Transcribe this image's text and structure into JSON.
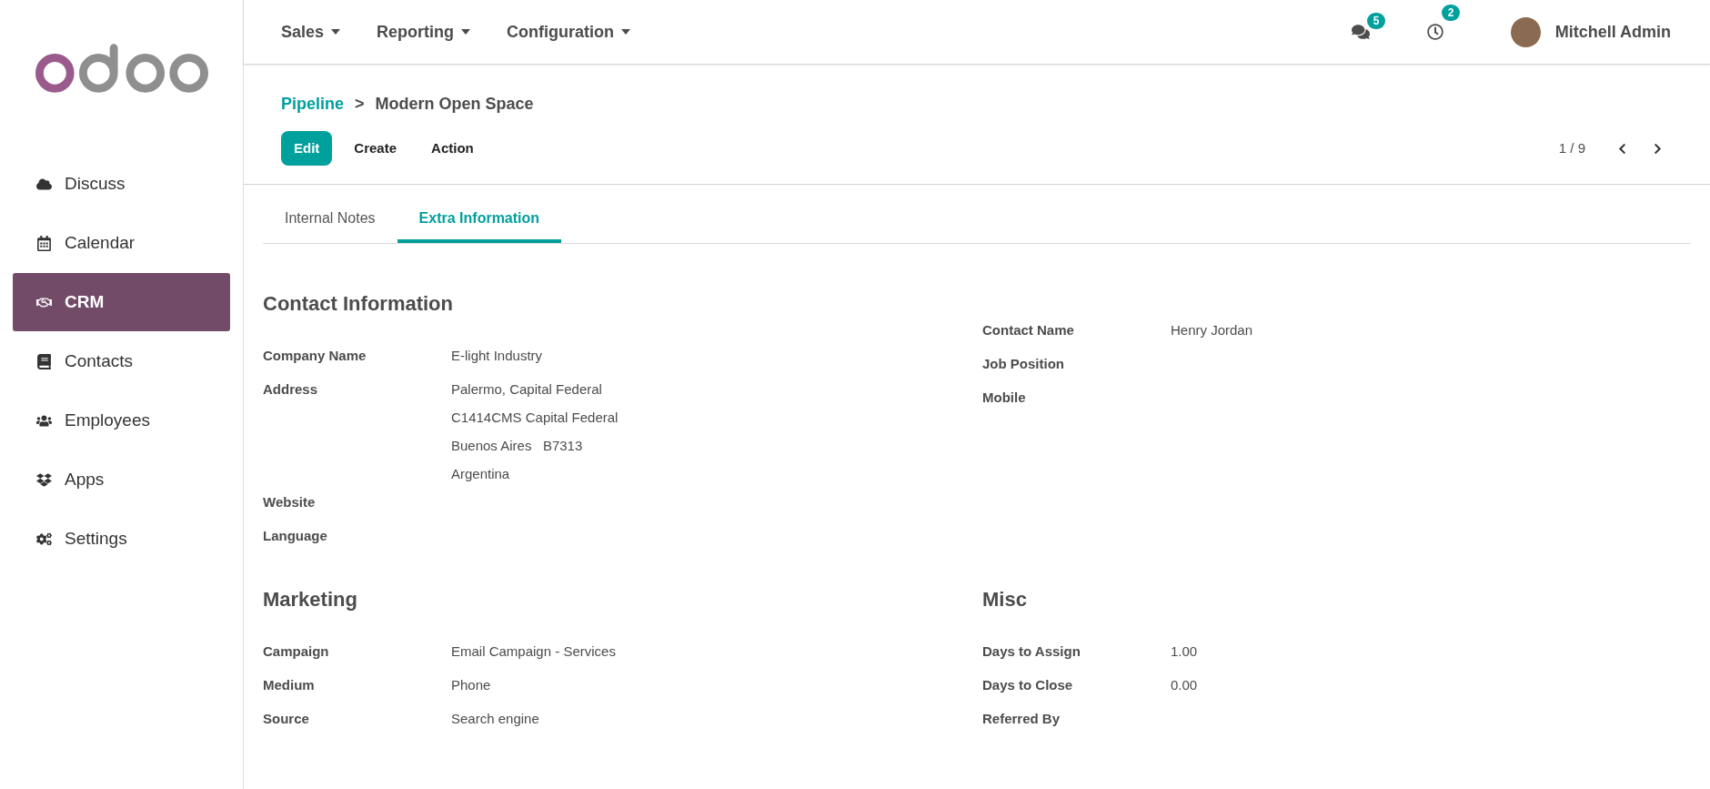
{
  "sidebar": {
    "items": [
      {
        "label": "Discuss",
        "selected": false
      },
      {
        "label": "Calendar",
        "selected": false
      },
      {
        "label": "CRM",
        "selected": true
      },
      {
        "label": "Contacts",
        "selected": false
      },
      {
        "label": "Employees",
        "selected": false
      },
      {
        "label": "Apps",
        "selected": false
      },
      {
        "label": "Settings",
        "selected": false
      }
    ]
  },
  "topbar": {
    "menus": [
      "Sales",
      "Reporting",
      "Configuration"
    ],
    "messages_badge": "5",
    "activities_badge": "2",
    "user": "Mitchell Admin"
  },
  "breadcrumb": {
    "parent": "Pipeline",
    "separator": ">",
    "current": "Modern Open Space"
  },
  "actions": {
    "buttons": [
      {
        "label": "Edit",
        "kind": "primary"
      },
      {
        "label": "Create",
        "kind": "plain"
      },
      {
        "label": "Action",
        "kind": "plain"
      }
    ],
    "pager": "1 / 9"
  },
  "tabs": [
    {
      "label": "Internal Notes",
      "selected": false
    },
    {
      "label": "Extra Information",
      "selected": true
    }
  ],
  "sections": [
    {
      "title": "Contact Information",
      "fields": [
        {
          "label": "Company Name",
          "value": [
            "E-light Industry"
          ]
        },
        {
          "label": "Address",
          "value": [
            "Palermo, Capital Federal",
            "C1414CMS Capital Federal",
            "Buenos Aires   B7313",
            "Argentina"
          ]
        },
        {
          "label": "Website"
        },
        {
          "label": "Language"
        }
      ]
    },
    {
      "fields": [
        {
          "label": "Contact Name",
          "value": [
            "Henry Jordan"
          ]
        },
        {
          "label": "Job Position"
        },
        {
          "label": "Mobile"
        }
      ]
    },
    {
      "title": "Marketing",
      "fields": [
        {
          "label": "Campaign",
          "value": [
            "Email Campaign - Services"
          ]
        },
        {
          "label": "Medium",
          "value": [
            "Phone"
          ]
        },
        {
          "label": "Source",
          "value": [
            "Search engine"
          ]
        }
      ]
    },
    {
      "title": "Misc",
      "fields": [
        {
          "label": "Days to Assign",
          "value": [
            "1.00"
          ]
        },
        {
          "label": "Days to Close",
          "value": [
            "0.00"
          ]
        },
        {
          "label": "Referred By"
        }
      ]
    }
  ]
}
